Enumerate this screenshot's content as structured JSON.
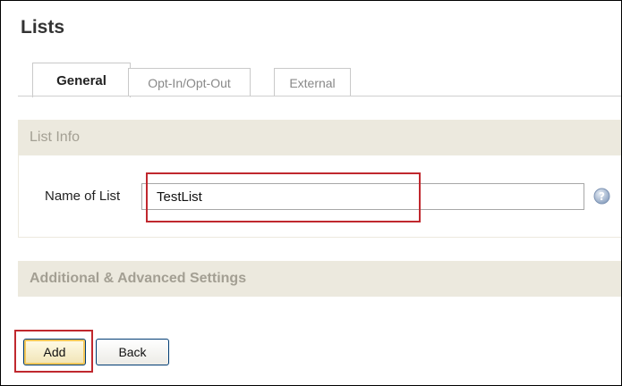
{
  "page": {
    "title": "Lists"
  },
  "tabs": [
    {
      "label": "General",
      "active": true
    },
    {
      "label": "Opt-In/Opt-Out",
      "active": false
    },
    {
      "label": "External",
      "active": false
    }
  ],
  "sections": {
    "list_info": {
      "title": "List Info"
    },
    "advanced": {
      "title": "Additional & Advanced Settings"
    }
  },
  "form": {
    "name_label": "Name of List",
    "name_value": "TestList"
  },
  "actions": {
    "add_label": "Add",
    "back_label": "Back"
  },
  "icons": {
    "help": "help-icon"
  },
  "colors": {
    "highlight": "#c0282e",
    "section_bg": "#ece9de",
    "section_text": "#a39f93"
  }
}
